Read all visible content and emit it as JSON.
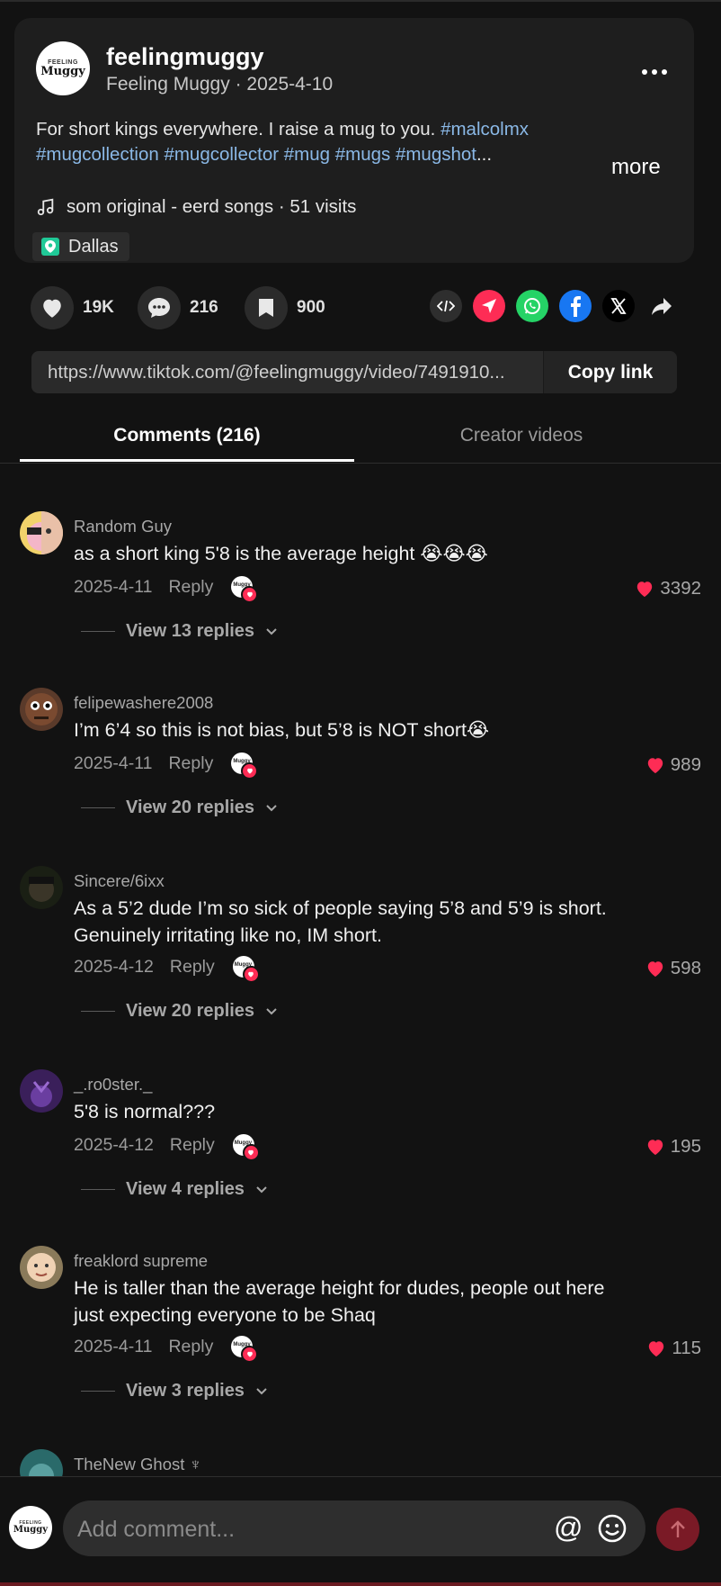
{
  "post": {
    "username": "feelingmuggy",
    "display_name": "Feeling Muggy",
    "date": "2025-4-10",
    "subline": "Feeling Muggy · 2025-4-10",
    "caption_text": "For short kings everywhere. I raise a mug to you. ",
    "tags_line1": "#malcolmx",
    "tags_line2": "#mugcollection #mugcollector #mug #mugs #mugshot",
    "ellipsis": "...",
    "more_label": "more",
    "sound": "som original - eerd songs · 51 visits",
    "location": "Dallas",
    "avatar_small_text": "FEELING",
    "avatar_big_text": "Muggy"
  },
  "actions": {
    "likes": "19K",
    "comments": "216",
    "saves": "900"
  },
  "link": {
    "url": "https://www.tiktok.com/@feelingmuggy/video/7491910...",
    "copy_label": "Copy link"
  },
  "tabs": {
    "comments": "Comments (216)",
    "creator": "Creator videos"
  },
  "comments": [
    {
      "user": "Random Guy",
      "text": "as a short king 5'8 is the average height 😭😭😭",
      "date": "2025-4-11",
      "reply": "Reply",
      "likes": "3392",
      "replies": "View 13 replies"
    },
    {
      "user": "felipewashere2008",
      "text": "I’m 6’4 so this is not bias, but 5’8 is NOT short😭",
      "date": "2025-4-11",
      "reply": "Reply",
      "likes": "989",
      "replies": "View 20 replies"
    },
    {
      "user": "Sincere/6ixx",
      "text": "As a 5’2 dude I’m so sick of people saying 5’8 and 5’9 is short. Genuinely irritating like no, IM short.",
      "date": "2025-4-12",
      "reply": "Reply",
      "likes": "598",
      "replies": "View 20 replies"
    },
    {
      "user": "_.ro0ster._",
      "text": "5'8 is normal???",
      "date": "2025-4-12",
      "reply": "Reply",
      "likes": "195",
      "replies": "View 4 replies"
    },
    {
      "user": "freaklord supreme",
      "text": "He is taller than the average height for dudes, people out here just expecting everyone to be Shaq",
      "date": "2025-4-11",
      "reply": "Reply",
      "likes": "115",
      "replies": "View 3 replies"
    },
    {
      "user": "TheNew Ghost ♆"
    }
  ],
  "composer": {
    "placeholder": "Add comment...",
    "at_label": "@"
  },
  "colors": {
    "background": "#121212",
    "card": "#1e1e1e",
    "hashtag": "#8ab8e6",
    "like_red": "#fe2c55",
    "send_disabled": "#7a1a26"
  }
}
